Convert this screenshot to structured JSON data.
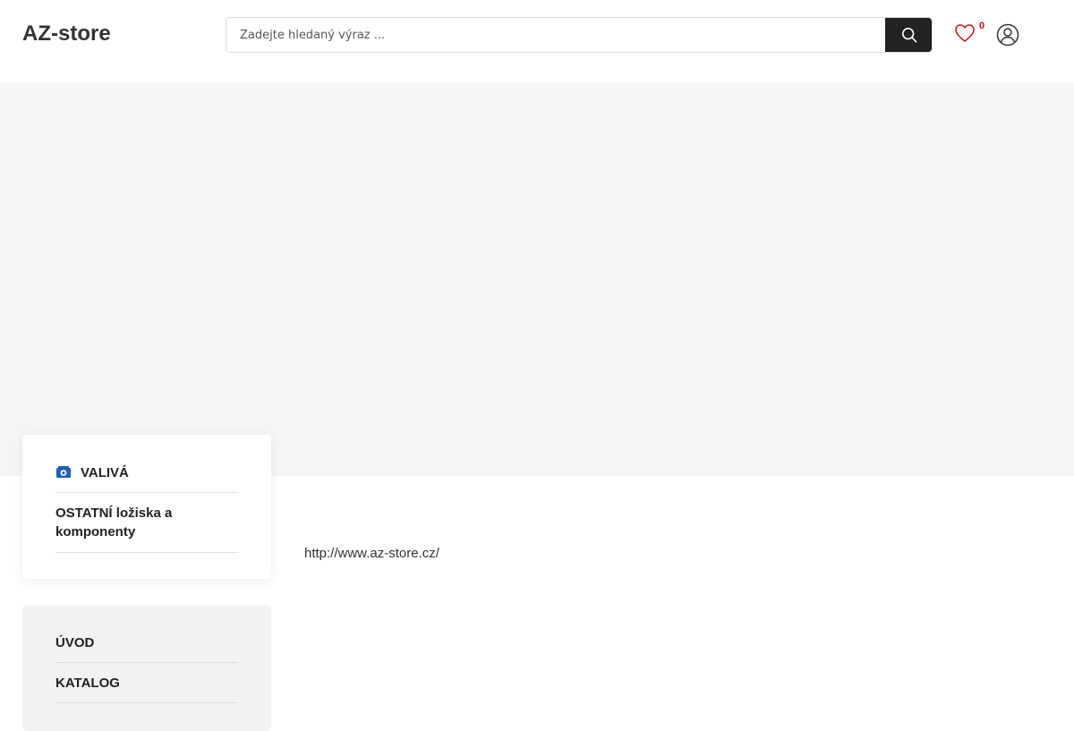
{
  "header": {
    "logo": "AZ-store",
    "search": {
      "placeholder": "Zadejte hledaný výraz ...",
      "value": ""
    },
    "wishlist_count": "0"
  },
  "sidebar": {
    "category": {
      "title": "VALIVÁ",
      "icon": "bearing-icon",
      "items": [
        {
          "label": "OSTATNÍ ložiska a komponenty"
        }
      ]
    },
    "nav": [
      {
        "label": "ÚVOD"
      },
      {
        "label": "KATALOG"
      }
    ]
  },
  "main": {
    "url_text": "http://www.az-store.cz/"
  },
  "colors": {
    "accent_badge": "#d01010",
    "search_button": "#222222",
    "hero_bg": "#f6f6f6",
    "icon_blue": "#1f5fb4"
  }
}
